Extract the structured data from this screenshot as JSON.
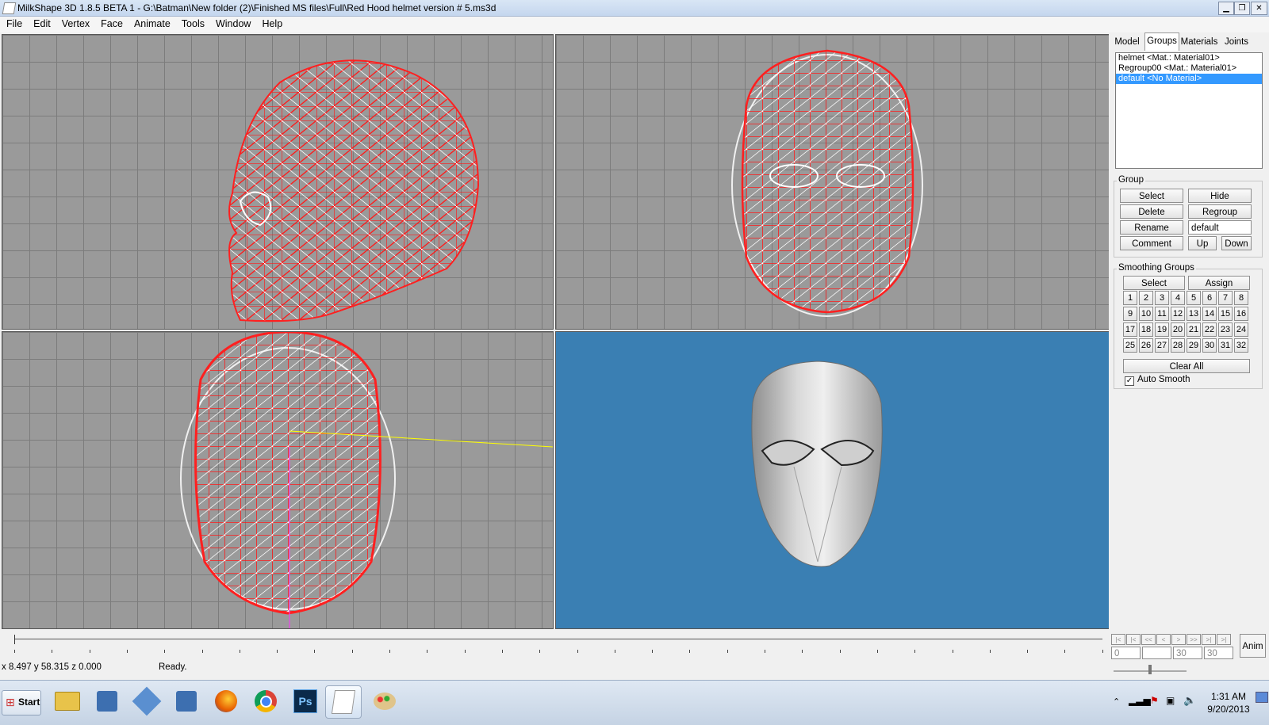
{
  "window": {
    "title": "MilkShape 3D 1.8.5 BETA 1 - G:\\Batman\\New folder (2)\\Finished MS files\\Full\\Red Hood helmet version # 5.ms3d"
  },
  "window_controls": {
    "minimize": "▁",
    "restore": "❐",
    "close": "✕"
  },
  "menu": [
    "File",
    "Edit",
    "Vertex",
    "Face",
    "Animate",
    "Tools",
    "Window",
    "Help"
  ],
  "tabs": [
    "Model",
    "Groups",
    "Materials",
    "Joints"
  ],
  "groups_list": [
    "helmet <Mat.: Material01>",
    "Regroup00 <Mat.: Material01>",
    "default <No Material>"
  ],
  "group_box": {
    "label": "Group",
    "select": "Select",
    "hide": "Hide",
    "delete": "Delete",
    "regroup": "Regroup",
    "rename": "Rename",
    "rename_value": "default",
    "comment": "Comment",
    "up": "Up",
    "down": "Down"
  },
  "smoothing": {
    "label": "Smoothing Groups",
    "select": "Select",
    "assign": "Assign",
    "numbers": [
      "1",
      "2",
      "3",
      "4",
      "5",
      "6",
      "7",
      "8",
      "9",
      "10",
      "11",
      "12",
      "13",
      "14",
      "15",
      "16",
      "17",
      "18",
      "19",
      "20",
      "21",
      "22",
      "23",
      "24",
      "25",
      "26",
      "27",
      "28",
      "29",
      "30",
      "31",
      "32"
    ],
    "clear_all": "Clear All",
    "auto_smooth": "Auto Smooth",
    "auto_smooth_checked": true
  },
  "anim_controls": {
    "buttons": [
      "|<",
      "|<",
      "<<",
      "<",
      ">",
      ">>",
      ">|",
      ">|"
    ],
    "fields": [
      "0",
      "",
      "30",
      "30"
    ],
    "anim_label": "Anim"
  },
  "status": {
    "coords": "x 8.497 y 58.315 z 0.000",
    "message": "Ready."
  },
  "taskbar": {
    "start": "Start",
    "apps": [
      "folder-icon",
      "network-icon",
      "app-icon",
      "network2-icon",
      "firefox-icon",
      "chrome-icon",
      "photoshop-icon",
      "milkshape-icon",
      "paint-icon"
    ],
    "photoshop_label": "Ps",
    "clock_time": "1:31 AM",
    "clock_date": "9/20/2013"
  },
  "colors": {
    "viewport_grid": "#9a9a9a",
    "wire_red": "#ff0000",
    "render_bg": "#3a7fb3",
    "selection": "#3399ff"
  }
}
